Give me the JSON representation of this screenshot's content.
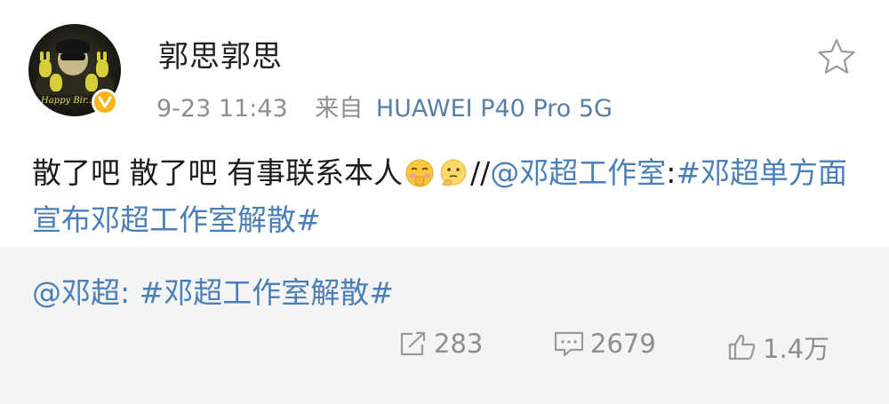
{
  "post": {
    "username": "郭思郭思",
    "time": "9-23 11:43",
    "source_prefix": "来自",
    "device": "HUAWEI P40 Pro 5G",
    "text_part1": "散了吧 散了吧 有事联系本人",
    "text_separator": "//",
    "mention": "@邓超工作室",
    "colon": ":",
    "hashtag": "#邓超单方面宣布邓超工作室解散#",
    "emojis": [
      "shy-face-emoji",
      "thinking-face-emoji"
    ],
    "avatar_text": "Happy Bir..."
  },
  "repost": {
    "mention": "@邓超",
    "colon": ": ",
    "hashtag": "#邓超工作室解散#"
  },
  "stats": {
    "shares": "283",
    "comments": "2679",
    "likes": "1.4万"
  },
  "colors": {
    "link": "#4a7fb7",
    "meta_gray": "#8e8e8e",
    "verified_badge": "#f6b51a",
    "repost_background": "#f4f4f4"
  }
}
